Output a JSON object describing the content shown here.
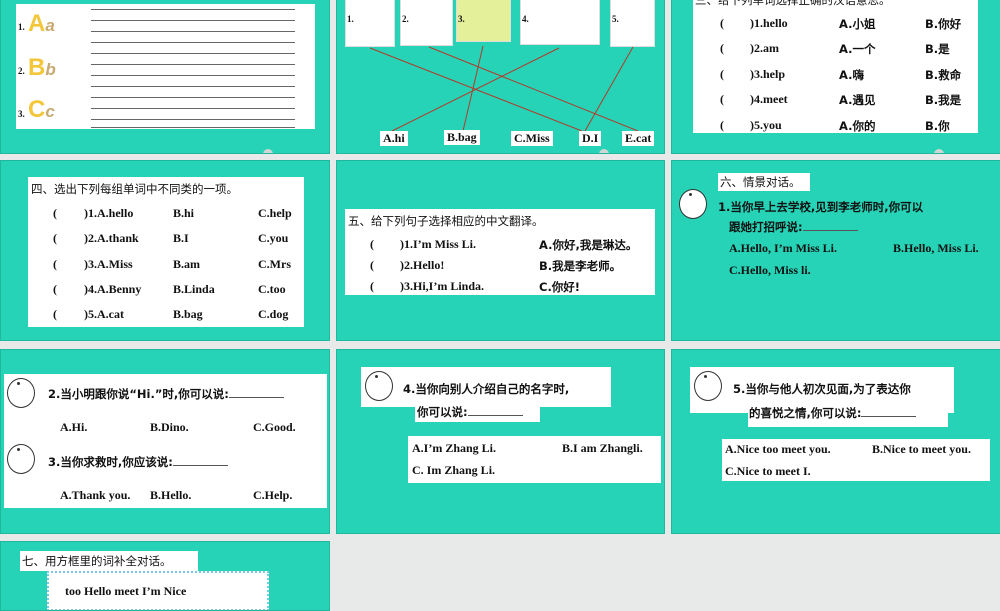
{
  "slide1": {
    "items": [
      "1.",
      "2.",
      "3."
    ],
    "letters": [
      [
        "A",
        "a"
      ],
      [
        "B",
        "b"
      ],
      [
        "C",
        "c"
      ]
    ]
  },
  "slide2": {
    "pictures": [
      "1.",
      "2.",
      "3.",
      "4.",
      "5."
    ],
    "labels": [
      "A.hi",
      "B.bag",
      "C.Miss",
      "D.I",
      "E.cat"
    ]
  },
  "slide3": {
    "title": "三、给下列单词选择正确的汉语意思。",
    "rows": [
      [
        "(",
        ")1.hello",
        "A.小姐",
        "B.你好"
      ],
      [
        "(",
        ")2.am",
        "A.一个",
        "B.是"
      ],
      [
        "(",
        ")3.help",
        "A.嗨",
        "B.救命"
      ],
      [
        "(",
        ")4.meet",
        "A.遇见",
        "B.我是"
      ],
      [
        "(",
        ")5.you",
        "A.你的",
        "B.你"
      ]
    ]
  },
  "slide4": {
    "title": "四、选出下列每组单词中不同类的一项。",
    "rows": [
      [
        "(",
        ")1.A.hello",
        "B.hi",
        "C.help"
      ],
      [
        "(",
        ")2.A.thank",
        "B.I",
        "C.you"
      ],
      [
        "(",
        ")3.A.Miss",
        "B.am",
        "C.Mrs"
      ],
      [
        "(",
        ")4.A.Benny",
        "B.Linda",
        "C.too"
      ],
      [
        "(",
        ")5.A.cat",
        "B.bag",
        "C.dog"
      ]
    ]
  },
  "slide5": {
    "title": "五、给下列句子选择相应的中文翻译。",
    "rows": [
      [
        "(",
        ")1.I’m Miss Li.",
        "A.你好,我是琳达。"
      ],
      [
        "(",
        ")2.Hello!",
        "B.我是李老师。"
      ],
      [
        "(",
        ")3.Hi,I’m Linda.",
        "C.你好!"
      ]
    ]
  },
  "slide6": {
    "title": "六、情景对话。",
    "q1": "1.当你早上去学校,见到李老师时,你可以",
    "q1b": "跟她打招呼说:",
    "a": "A.Hello, I’m Miss Li.",
    "b": "B.Hello, Miss Li.",
    "c": "C.Hello, Miss li."
  },
  "slide7": {
    "q2": "2.当小明跟你说“Hi.”时,你可以说:",
    "q2opts": [
      "A.Hi.",
      "B.Dino.",
      "C.Good."
    ],
    "q3": "3.当你求救时,你应该说:",
    "q3opts": [
      "A.Thank you.",
      "B.Hello.",
      "C.Help."
    ]
  },
  "slide8": {
    "q4": "4.当你向别人介绍自己的名字时,",
    "q4b": "你可以说:",
    "a": "A.I’m Zhang Li.",
    "b": "B.I am Zhangli.",
    "c": "C. Im Zhang Li."
  },
  "slide9": {
    "q5": "5.当你与他人初次见面,为了表达你",
    "q5b": "的喜悦之情,你可以说:",
    "a": "A.Nice too meet you.",
    "b": "B.Nice to meet you.",
    "c": "C.Nice to meet I."
  },
  "slide10": {
    "title": "七、用方框里的词补全对话。",
    "words": "too   Hello   meet   I’m   Nice"
  }
}
